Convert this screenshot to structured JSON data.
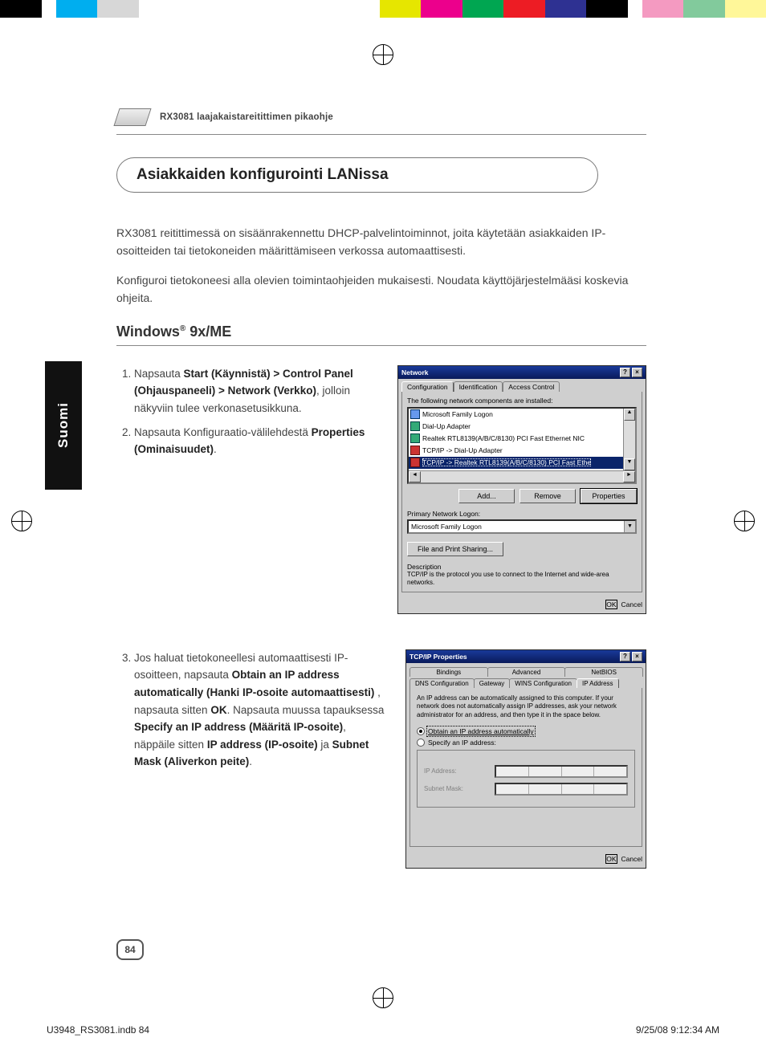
{
  "color_bar": [
    "#000000",
    "#ffffff",
    "#00aeef",
    "#d7d7d7",
    "#ffffff",
    "#ffffff",
    "#ffffff",
    "#e6e600",
    "#ec008c",
    "#00a651",
    "#ed1c24",
    "#2e3192",
    "#000000",
    "#ffffff",
    "#f49ac1",
    "#82ca9c",
    "#fff799"
  ],
  "doc_header": "RX3081 laajakaistareitittimen pikaohje",
  "section_title": "Asiakkaiden konfigurointi LANissa",
  "intro_1": "RX3081 reitittimessä on sisäänrakennettu DHCP-palvelintoiminnot, joita käytetään asiakkaiden IP-osoitteiden tai tietokoneiden määrittämiseen verkossa automaattisesti.",
  "intro_2": "Konfiguroi tietokoneesi alla olevien toimintaohjeiden mukaisesti. Noudata käyttöjärjestelmääsi koskevia ohjeita.",
  "sub_head_prefix": "Windows",
  "sub_head_suffix": " 9x/ME",
  "steps_a": {
    "1_pre": "Napsauta ",
    "1_bold": "Start (Käynnistä) > Control Panel (Ohjauspaneeli) > Network (Verkko)",
    "1_post": ", jolloin näkyviin  tulee verkonasetusikkuna.",
    "2_pre": "Napsauta Konfiguraatio-välilehdestä ",
    "2_bold": "Properties (Ominaisuudet)",
    "2_post": "."
  },
  "steps_b": {
    "3_pre": "Jos haluat tietokoneellesi automaattisesti IP-osoitteen, napsauta ",
    "3_b1": "Obtain an IP address automatically (Hanki IP-osoite automaattisesti)",
    "3_mid1": " , napsauta sitten ",
    "3_b2": "OK",
    "3_mid2": ". Napsauta muussa tapauksessa ",
    "3_b3": "Specify an IP address (Määritä IP-osoite)",
    "3_mid3": ", näppäile sitten ",
    "3_b4": "IP address (IP-osoite)",
    "3_mid4": " ja ",
    "3_b5": "Subnet Mask (Aliverkon peite)",
    "3_post": "."
  },
  "network_dialog": {
    "title": "Network",
    "help_btn": "?",
    "close_btn": "×",
    "tabs": [
      "Configuration",
      "Identification",
      "Access Control"
    ],
    "list_label": "The following network components are installed:",
    "items": [
      {
        "icon": "blue",
        "text": "Microsoft Family Logon"
      },
      {
        "icon": "green",
        "text": "Dial-Up Adapter"
      },
      {
        "icon": "green",
        "text": "Realtek RTL8139(A/B/C/8130) PCI Fast Ethernet NIC"
      },
      {
        "icon": "red",
        "text": "TCP/IP -> Dial-Up Adapter"
      }
    ],
    "selected_item": "TCP/IP -> Realtek RTL8139(A/B/C/8130) PCI Fast Ethe",
    "scroll_up": "▲",
    "scroll_down": "▼",
    "scroll_left": "◄",
    "scroll_right": "►",
    "btn_add": "Add...",
    "btn_remove": "Remove",
    "btn_props": "Properties",
    "primary_label": "Primary Network Logon:",
    "primary_value": "Microsoft Family Logon",
    "combo_arrow": "▼",
    "btn_fileprint": "File and Print Sharing...",
    "desc_label": "Description",
    "desc_text": "TCP/IP is the protocol you use to connect to the Internet and wide-area networks.",
    "ok": "OK",
    "cancel": "Cancel"
  },
  "tcpip_dialog": {
    "title": "TCP/IP Properties",
    "help_btn": "?",
    "close_btn": "×",
    "tabs_row1": [
      "Bindings",
      "Advanced",
      "NetBIOS"
    ],
    "tabs_row2": [
      "DNS Configuration",
      "Gateway",
      "WINS Configuration",
      "IP Address"
    ],
    "intro": "An IP address can be automatically assigned to this computer. If your network does not automatically assign IP addresses, ask your network administrator for an address, and then type it in the space below.",
    "radio_obtain": "Obtain an IP address automatically",
    "radio_specify": "Specify an IP address:",
    "lbl_ip": "IP Address:",
    "lbl_mask": "Subnet Mask:",
    "ok": "OK",
    "cancel": "Cancel"
  },
  "side_tab": "Suomi",
  "page_number": "84",
  "footer_file": "U3948_RS3081.indb   84",
  "footer_date": "9/25/08   9:12:34 AM"
}
